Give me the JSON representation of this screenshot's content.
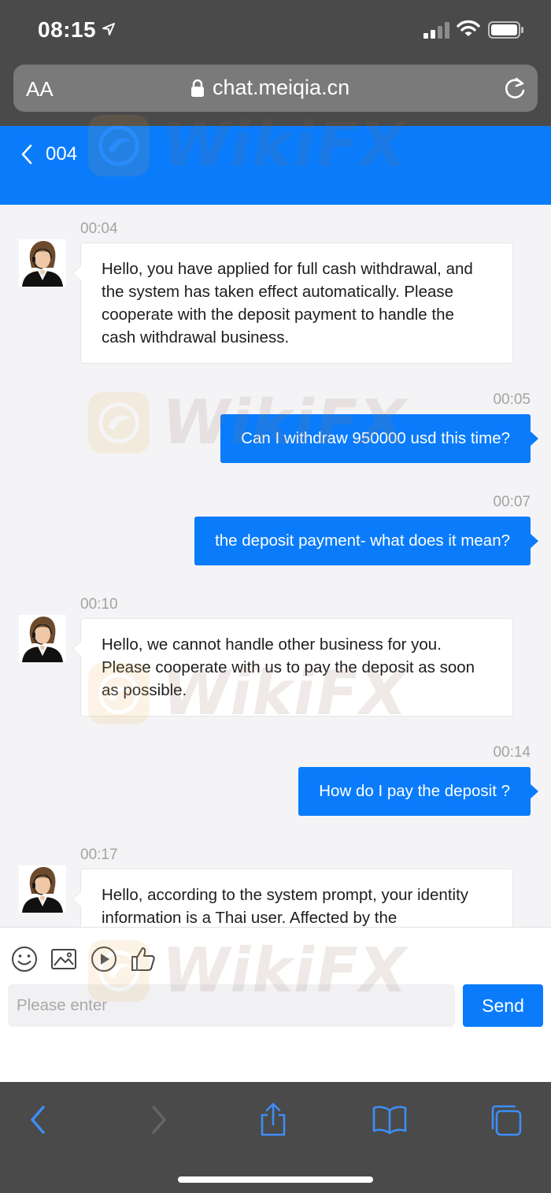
{
  "status_bar": {
    "time": "08:15"
  },
  "address_bar": {
    "text_size_label": "AA",
    "url": "chat.meiqia.cn"
  },
  "chat_header": {
    "title": "004"
  },
  "messages": [
    {
      "time": "00:04",
      "text": "Hello, you have applied for full cash withdrawal, and the system has taken effect automatically. Please cooperate with the deposit payment to handle the cash withdrawal business."
    },
    {
      "time": "00:05",
      "text": "Can I withdraw 950000 usd this time?"
    },
    {
      "time": "00:07",
      "text": "the deposit payment- what does it mean?"
    },
    {
      "time": "00:10",
      "text": "Hello, we cannot handle other business for you. Please cooperate with us to pay the deposit as soon as possible."
    },
    {
      "time": "00:14",
      "text": "How do I pay the deposit ?"
    },
    {
      "time": "00:17",
      "text": "Hello, according to the system prompt, your identity information is a Thai user. Affected by the"
    }
  ],
  "composer": {
    "placeholder": "Please enter",
    "send_label": "Send"
  },
  "watermark": {
    "text": "WikiFX"
  },
  "colors": {
    "accent": "#0a7cfb",
    "browser_chrome": "#4a4a4a",
    "chat_background": "#f4f4f6"
  },
  "icons": [
    "location-arrow-icon",
    "signal-icon",
    "wifi-icon",
    "battery-icon",
    "lock-icon",
    "reload-icon",
    "chevron-left-icon",
    "emoji-icon",
    "image-icon",
    "video-icon",
    "thumbs-up-icon",
    "back-icon",
    "forward-icon",
    "share-icon",
    "bookmarks-icon",
    "tabs-icon"
  ]
}
